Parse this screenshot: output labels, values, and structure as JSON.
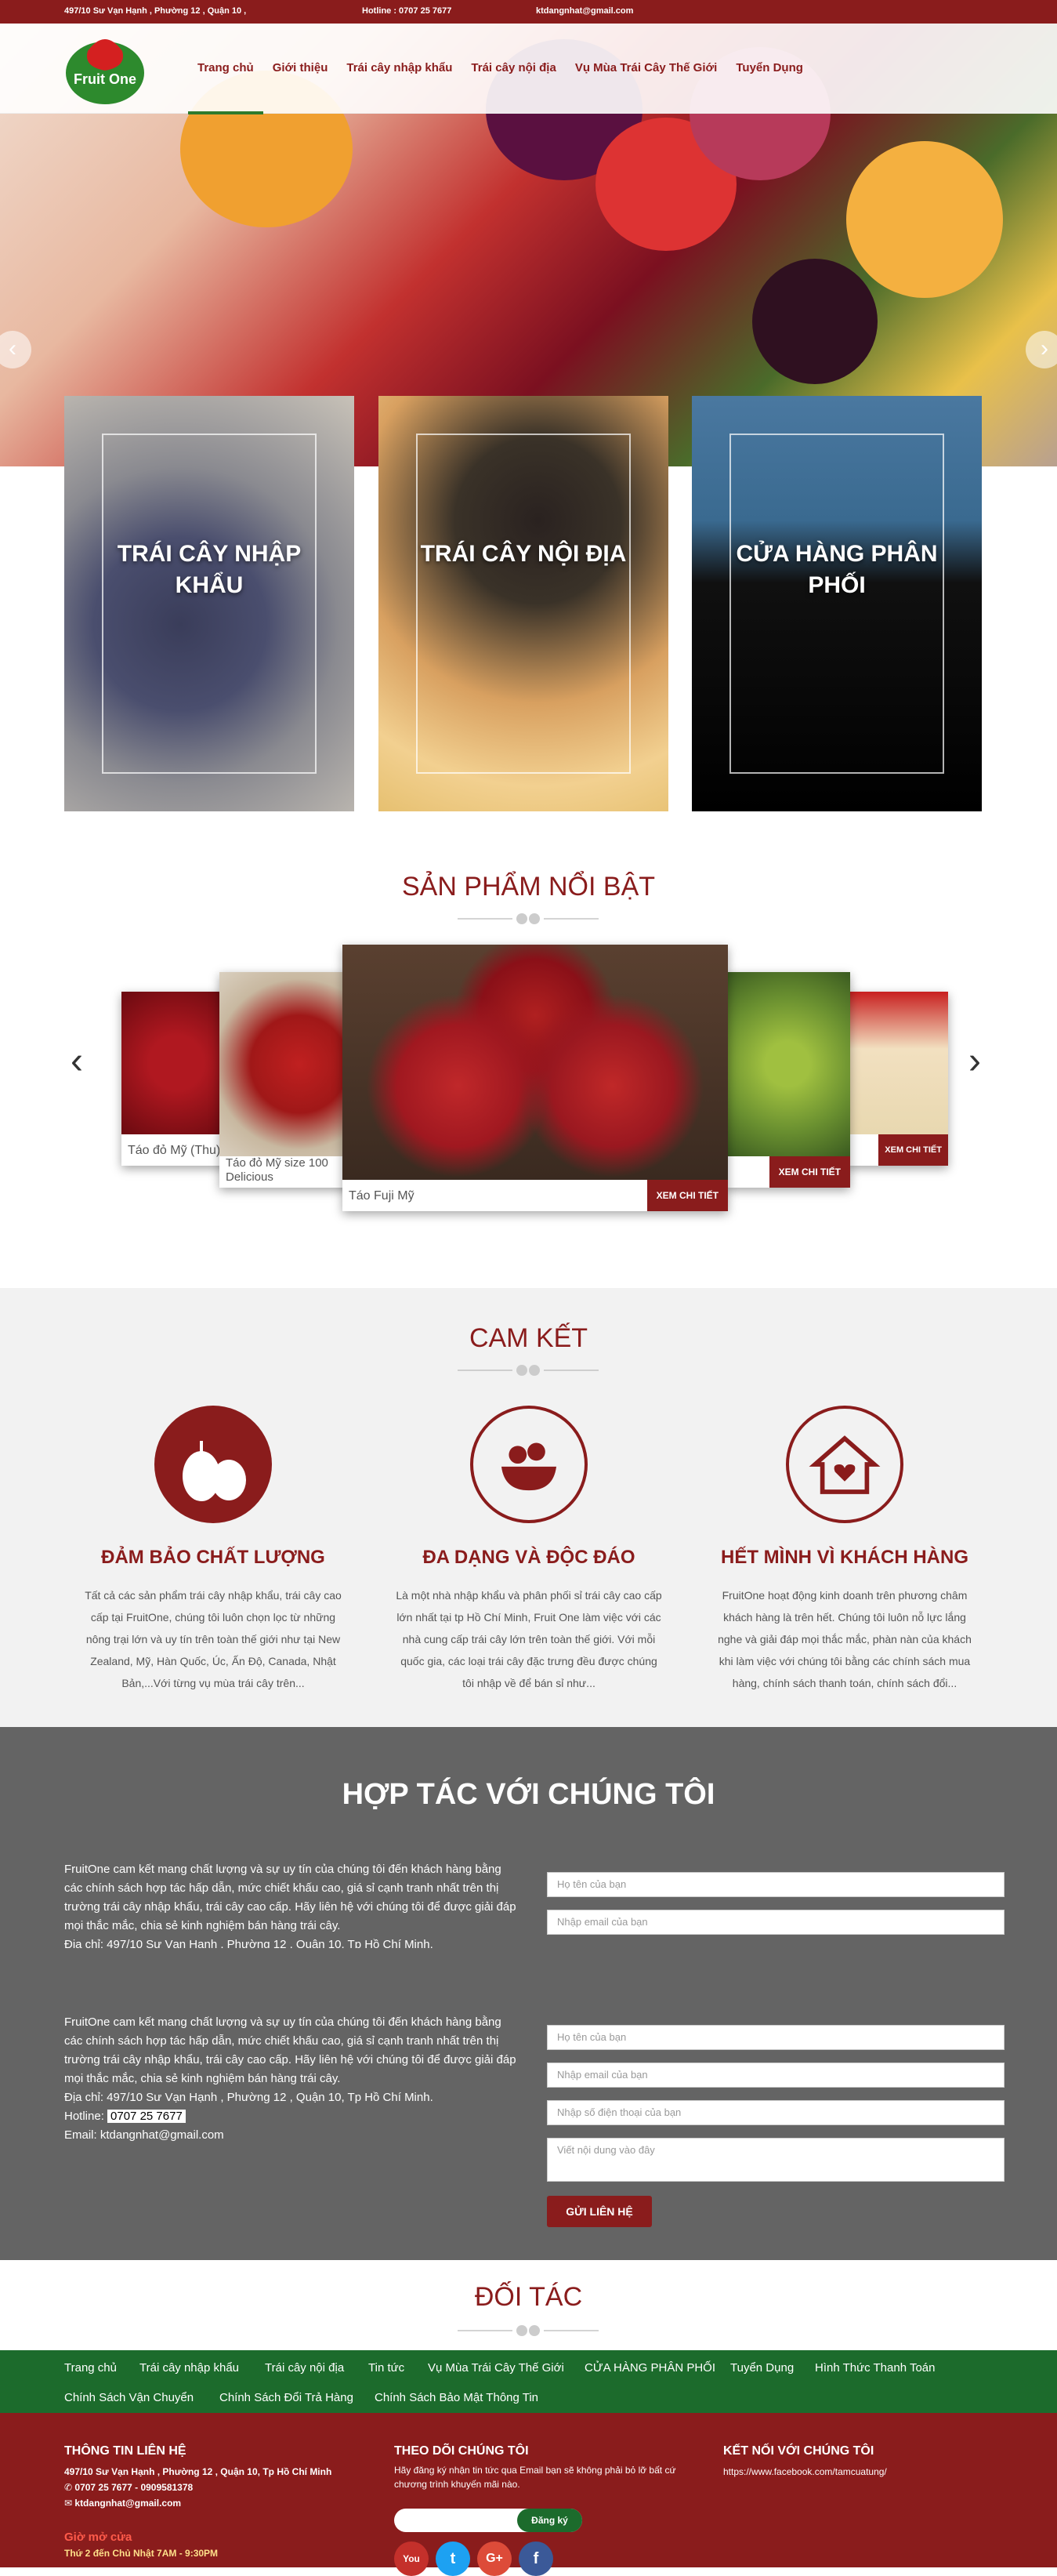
{
  "topbar": {
    "address": "497/10 Sư Vạn Hạnh , Phường 12 , Quận 10 ,",
    "hotline": "Hotline : 0707 25 7677",
    "email": "ktdangnhat@gmail.com"
  },
  "logo": {
    "text": "Fruit One"
  },
  "nav": [
    "Trang chủ",
    "Giới thiệu",
    "Trái cây nhập khẩu",
    "Trái cây nội địa",
    "Vụ Mùa Trái Cây Thế Giới",
    "Tuyển Dụng"
  ],
  "categories": [
    "TRÁI CÂY NHẬP KHẨU",
    "TRÁI CÂY NỘI ĐỊA",
    "CỬA HÀNG PHÂN PHỐI"
  ],
  "featured": {
    "title": "SẢN PHẨM NỔI BẬT",
    "button": "XEM CHI TIẾT",
    "products": [
      "Táo đỏ Mỹ (Thu)",
      "Táo đỏ Mỹ size 100 Delicious",
      "Táo Fuji Mỹ"
    ]
  },
  "commit": {
    "title": "CAM KẾT",
    "items": [
      {
        "icon": "pear-icon",
        "title": "ĐẢM BẢO CHẤT LƯỢNG",
        "text": "Tất cả các sản phẩm trái cây nhập khẩu, trái cây cao cấp tại FruitOne, chúng tôi luôn chọn lọc từ những nông trại lớn và uy tín trên toàn thế giới như tại New Zealand, Mỹ, Hàn Quốc, Úc, Ấn Độ, Canada, Nhật Bản,...Với từng vụ mùa trái cây trên..."
      },
      {
        "icon": "fruit-bowl-icon",
        "title": "ĐA DẠNG VÀ ĐỘC ĐÁO",
        "text": "Là một nhà nhập khẩu và phân phối sỉ trái cây cao cấp lớn nhất tại tp Hồ Chí Minh, Fruit One làm việc với các nhà cung cấp trái cây lớn trên toàn thế giới. Với mỗi quốc gia, các loại trái cây đặc trưng đều được chúng tôi nhập về để bán sỉ như..."
      },
      {
        "icon": "home-heart-icon",
        "title": "HẾT MÌNH VÌ KHÁCH HÀNG",
        "text": "FruitOne hoạt động kinh doanh trên phương châm khách hàng là trên hết. Chúng tôi luôn nỗ lực lắng nghe và giải đáp mọi thắc mắc, phàn nàn của khách khi làm việc với chúng tôi bằng các chính sách mua hàng, chính sách thanh toán, chính sách đổi..."
      }
    ]
  },
  "coop": {
    "title": "HỢP TÁC VỚI CHÚNG TÔI",
    "text": "FruitOne cam kết mang chất lượng và sự uy tín của chúng tôi đến khách hàng bằng các chính sách hợp tác hấp dẫn, mức chiết khấu cao, giá sỉ cạnh tranh nhất trên thị trường trái cây nhập khẩu, trái cây cao cấp. Hãy liên hệ với chúng tôi để được giải đáp mọi thắc mắc, chia sẻ kinh nghiệm bán hàng trái cây.",
    "address": "Địa chỉ: 497/10 Sư Vạn Hạnh , Phường 12 , Quận 10, Tp Hồ Chí Minh.",
    "hotline_label": "Hotline:",
    "hotline": "0707 25 7677",
    "email": "Email: ktdangnhat@gmail.com",
    "ph_name": "Họ tên của bạn",
    "ph_email": "Nhập email của bạn",
    "ph_phone": "Nhập số điện thoại của bạn",
    "ph_msg": "Viết nội dung vào đây",
    "send": "GỬI LIÊN HỆ"
  },
  "partners": {
    "title": "ĐỐI TÁC"
  },
  "footnav": [
    "Trang chủ",
    "Trái cây nhập khẩu",
    "Trái cây nội địa",
    "Tin tức",
    "Vụ Mùa Trái Cây Thế Giới",
    "CỬA HÀNG PHÂN PHỐI",
    "Tuyển Dụng",
    "Hình Thức Thanh Toán",
    "Chính Sách Vận Chuyển",
    "Chính Sách Đổi Trả Hàng",
    "Chính Sách Bảo Mật Thông Tin"
  ],
  "footer": {
    "info_title": "THÔNG TIN LIÊN HỆ",
    "address": "497/10 Sư Vạn Hạnh , Phường 12 , Quận 10, Tp Hồ Chí Minh",
    "phone": "✆ 0707 25 7677 - 0909581378",
    "email": "✉ ktdangnhat@gmail.com",
    "hours_title": "Giờ mở cửa",
    "hours": "Thứ 2 đến Chủ Nhật 7AM - 9:30PM",
    "follow_title": "THEO DÕI CHÚNG TÔI",
    "follow_text": "Hãy đăng ký nhận tin tức qua Email bạn sẽ không phải bỏ lỡ bất cứ chương trình khuyến mãi nào.",
    "subscribe": "Đăng ký",
    "connect_title": "KẾT NỐI VỚI CHÚNG TÔI",
    "facebook": "https://www.facebook.com/tamcuatung/"
  },
  "colors": {
    "brand": "#8a1c1c",
    "green": "#1c6b2c",
    "gray": "#646464"
  }
}
